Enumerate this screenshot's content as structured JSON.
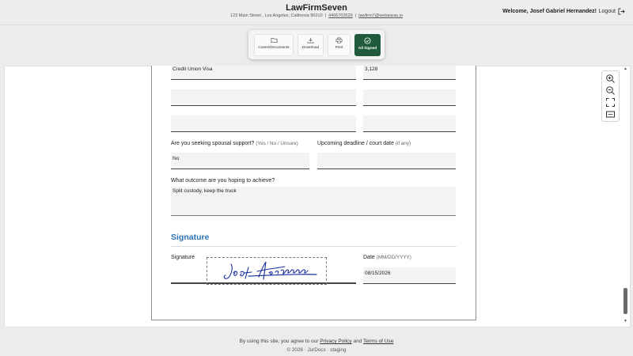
{
  "header": {
    "title": "LawFirmSeven",
    "address": "123 Main Street , Los Angeles, California 90210",
    "phone": "4406703529",
    "email": "lawfirm7@webareas.io",
    "welcome": "Welcome, Josef Gabriel Hernandez!",
    "logout": "Logout"
  },
  "toolbar": {
    "cases": "Cases/Documents",
    "download": "Download",
    "print": "Print",
    "all_signed": "All Signed",
    "accent_color": "#1f5a3a"
  },
  "form": {
    "debt_rows": [
      {
        "name": "Credit Union Visa",
        "amount": "3,128"
      },
      {
        "name": "",
        "amount": ""
      },
      {
        "name": "",
        "amount": ""
      }
    ],
    "spousal_support_label": "Are you seeking spousal support?",
    "spousal_support_hint": "(Yes / No / Unsure)",
    "spousal_support_value": "No",
    "deadline_label": "Upcoming deadline / court date",
    "deadline_hint": "(if any)",
    "deadline_value": "",
    "outcome_label": "What outcome are you hoping to achieve?",
    "outcome_value": "Split custody, keep the truck",
    "signature_heading": "Signature",
    "signature_label": "Signature",
    "signature_handwriting": "Josef Hernandez",
    "date_label": "Date",
    "date_hint": "(MM/DD/YYYY)",
    "date_value": "08/15/2026",
    "heading_color": "#2b74b8"
  },
  "zoom_tools": [
    "zoom-in-icon",
    "zoom-out-icon",
    "fit-screen-icon",
    "fit-width-icon"
  ],
  "footer": {
    "consent_prefix": "By using this site, you agree to our",
    "privacy": "Privacy Policy",
    "and": "and",
    "terms": "Terms of Use",
    "copyright": "© 2026 · JurDocs · staging"
  }
}
